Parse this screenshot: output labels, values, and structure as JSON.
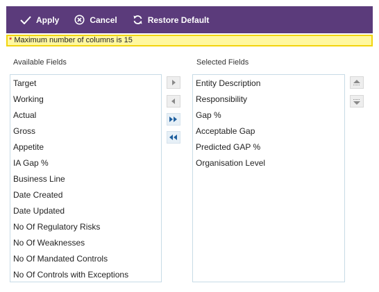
{
  "toolbar": {
    "apply_label": "Apply",
    "cancel_label": "Cancel",
    "restore_label": "Restore Default"
  },
  "notice": {
    "asterisk": "*",
    "message": " Maximum number of columns is 15"
  },
  "available": {
    "label": "Available Fields",
    "items": [
      "Target",
      "Working",
      "Actual",
      "Gross",
      "Appetite",
      "IA Gap %",
      "Business Line",
      "Date Created",
      "Date Updated",
      "No Of Regulatory Risks",
      "No Of Weaknesses",
      "No Of Mandated Controls",
      "No Of Controls with Exceptions"
    ]
  },
  "selected": {
    "label": "Selected Fields",
    "items": [
      "Entity Description",
      "Responsibility",
      "Gap %",
      "Acceptable Gap",
      "Predicted GAP %",
      "Organisation Level"
    ]
  },
  "colors": {
    "toolbar_bg": "#5b3b7b",
    "notice_bg": "#fff8a0",
    "notice_border": "#f2d40f",
    "list_border": "#c7dbe6"
  }
}
